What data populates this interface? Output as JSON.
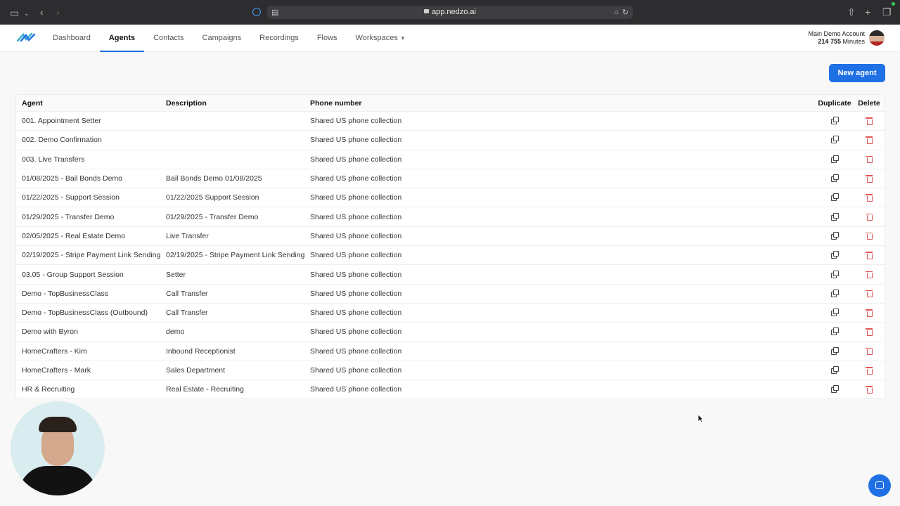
{
  "browser": {
    "url": "app.nedzo.ai"
  },
  "nav": {
    "items": [
      {
        "label": "Dashboard"
      },
      {
        "label": "Agents"
      },
      {
        "label": "Contacts"
      },
      {
        "label": "Campaigns"
      },
      {
        "label": "Recordings"
      },
      {
        "label": "Flows"
      },
      {
        "label": "Workspaces"
      }
    ],
    "active": "Agents"
  },
  "account": {
    "name": "Main Demo Account",
    "minutes_value": "214 755",
    "minutes_unit": "Minutes"
  },
  "toolbar": {
    "new_agent_label": "New agent"
  },
  "table": {
    "headers": {
      "agent": "Agent",
      "description": "Description",
      "phone": "Phone number",
      "duplicate": "Duplicate",
      "delete": "Delete"
    },
    "rows": [
      {
        "agent": "001. Appointment Setter",
        "description": "",
        "phone": "Shared US phone collection"
      },
      {
        "agent": "002. Demo Confirmation",
        "description": "",
        "phone": "Shared US phone collection"
      },
      {
        "agent": "003. Live Transfers",
        "description": "",
        "phone": "Shared US phone collection"
      },
      {
        "agent": "01/08/2025 - Bail Bonds Demo",
        "description": "Bail Bonds Demo 01/08/2025",
        "phone": "Shared US phone collection"
      },
      {
        "agent": "01/22/2025 - Support Session",
        "description": "01/22/2025 Support Session",
        "phone": "Shared US phone collection"
      },
      {
        "agent": "01/29/2025 - Transfer Demo",
        "description": "01/29/2025 - Transfer Demo",
        "phone": "Shared US phone collection"
      },
      {
        "agent": "02/05/2025 - Real Estate Demo",
        "description": "Live Transfer",
        "phone": "Shared US phone collection"
      },
      {
        "agent": "02/19/2025 - Stripe Payment Link Sending",
        "description": "02/19/2025 - Stripe Payment Link Sending",
        "phone": "Shared US phone collection"
      },
      {
        "agent": "03.05 - Group Support Session",
        "description": "Setter",
        "phone": "Shared US phone collection"
      },
      {
        "agent": "Demo - TopBusinessClass",
        "description": "Call Transfer",
        "phone": "Shared US phone collection"
      },
      {
        "agent": "Demo - TopBusinessClass (Outbound)",
        "description": "Call Transfer",
        "phone": "Shared US phone collection"
      },
      {
        "agent": "Demo with Byron",
        "description": "demo",
        "phone": "Shared US phone collection"
      },
      {
        "agent": "HomeCrafters - Kim",
        "description": "Inbound Receptionist",
        "phone": "Shared US phone collection"
      },
      {
        "agent": "HomeCrafters - Mark",
        "description": "Sales Department",
        "phone": "Shared US phone collection"
      },
      {
        "agent": "HR & Recruiting",
        "description": "Real Estate - Recruiting",
        "phone": "Shared US phone collection"
      }
    ]
  },
  "colors": {
    "accent": "#1f6fe5",
    "delete": "#e25555"
  }
}
